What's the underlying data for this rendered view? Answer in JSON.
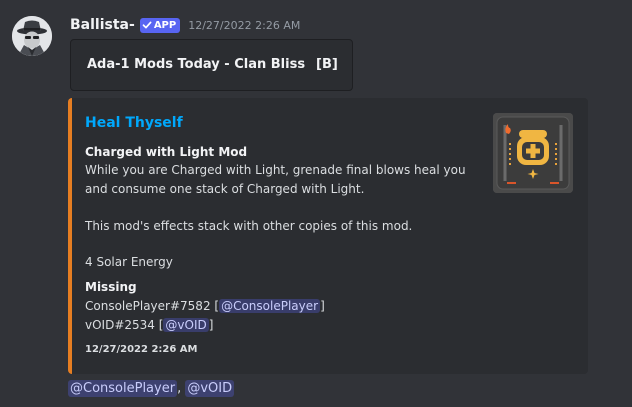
{
  "message": {
    "username": "Ballista-",
    "badge": "APP",
    "timestamp": "12/27/2022 2:26 AM",
    "code_block": {
      "title": "Ada-1 Mods Today - Clan Bliss",
      "tag": "[B]"
    },
    "embed": {
      "accent_color": "#e67e22",
      "title": "Heal Thyself",
      "mod_type": "Charged with Light Mod",
      "description_line1": "While you are Charged with Light, grenade final blows heal you",
      "description_line2": "and consume one stack of Charged with Light.",
      "stack_note": "This mod's effects stack with other copies of this mod.",
      "energy": "4 Solar Energy",
      "missing_label": "Missing",
      "missing": [
        {
          "player": "ConsolePlayer#7582",
          "mention": "@ConsolePlayer"
        },
        {
          "player": "vOID#2534",
          "mention": "@vOID"
        }
      ],
      "footer_timestamp": "12/27/2022 2:26 AM"
    },
    "mentions": {
      "first": "@ConsolePlayer",
      "separator": ",",
      "second": "@vOID"
    }
  },
  "colors": {
    "background": "#313338",
    "embed_background": "#2b2d31",
    "link": "#00a8fc",
    "badge": "#5865f2",
    "mention_text": "#c9cdfb"
  },
  "icons": {
    "avatar": "spy-avatar-icon",
    "badge_check": "checkmark-icon",
    "thumbnail": "solar-mod-icon"
  }
}
